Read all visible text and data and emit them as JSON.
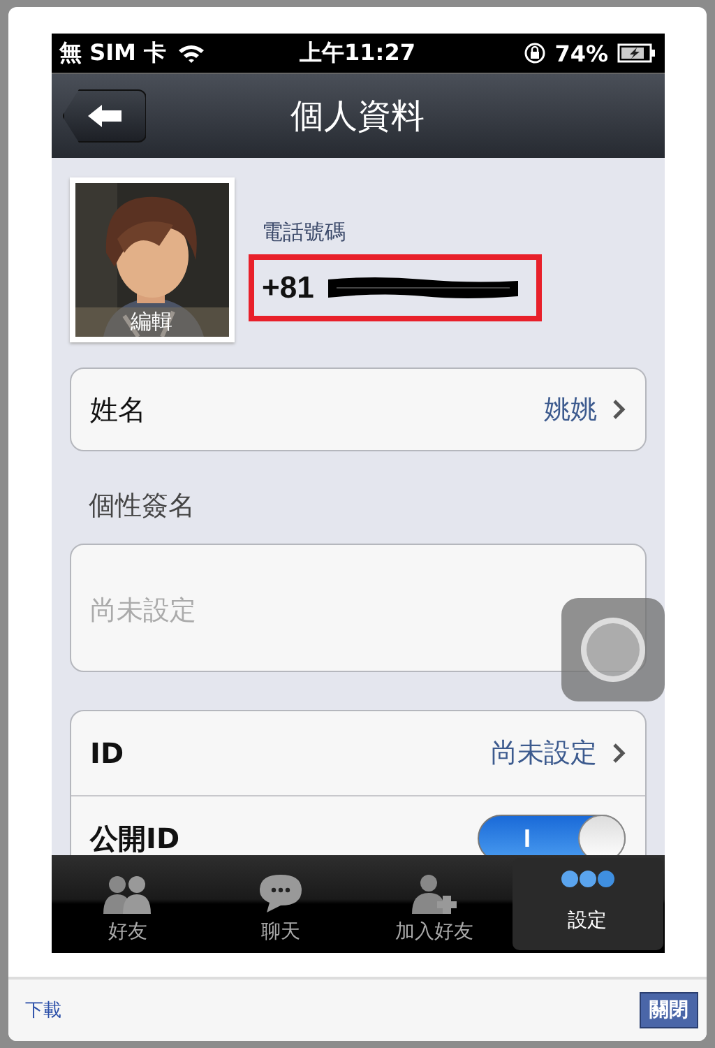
{
  "status_bar": {
    "carrier": "無 SIM 卡",
    "time": "上午11:27",
    "battery": "74%"
  },
  "nav": {
    "title": "個人資料"
  },
  "profile": {
    "edit_label": "編輯",
    "phone_label": "電話號碼",
    "phone_prefix": "+81",
    "phone_redacted": true
  },
  "name_row": {
    "label": "姓名",
    "value": "姚姚"
  },
  "signature": {
    "heading": "個性簽名",
    "placeholder": "尚未設定"
  },
  "id_rows": [
    {
      "kind": "link",
      "label": "ID",
      "value": "尚未設定"
    },
    {
      "kind": "toggle",
      "label": "公開ID",
      "on": true,
      "toggle_text": "I"
    }
  ],
  "tabs": [
    {
      "label": "好友",
      "kind": "friends",
      "selected": false
    },
    {
      "label": "聊天",
      "kind": "chat",
      "selected": false
    },
    {
      "label": "加入好友",
      "kind": "add",
      "selected": false
    },
    {
      "label": "設定",
      "kind": "more",
      "selected": true
    }
  ],
  "footer": {
    "link": "下載",
    "button": "關閉"
  }
}
